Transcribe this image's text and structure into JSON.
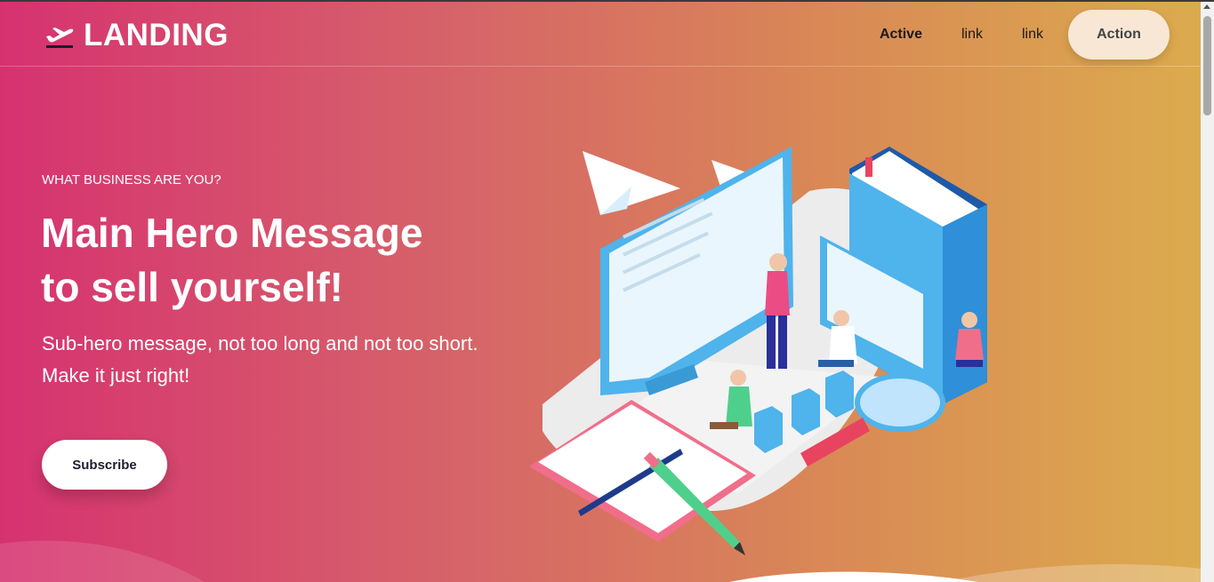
{
  "header": {
    "brand": "LANDING",
    "brand_icon": "airplane-takeoff-icon",
    "nav": {
      "active_label": "Active",
      "link1_label": "link",
      "link2_label": "link",
      "action_label": "Action"
    }
  },
  "hero": {
    "eyebrow": "WHAT BUSINESS ARE YOU?",
    "title_line1": "Main Hero Message",
    "title_line2": "to sell yourself!",
    "subtitle": "Sub-hero message, not too long and not too short. Make it just right!",
    "cta_label": "Subscribe"
  },
  "colors": {
    "gradient_start": "#d63270",
    "gradient_end": "#dcab4e",
    "action_button_bg": "#f7e7d4"
  }
}
